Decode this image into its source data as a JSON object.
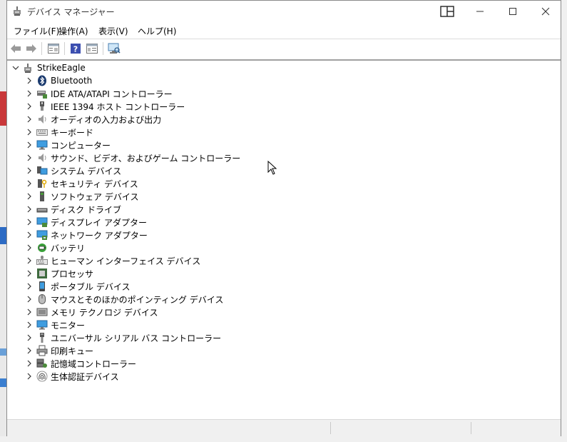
{
  "window": {
    "title": "デバイス マネージャー"
  },
  "menu": [
    "ファイル(F)",
    "操作(A)",
    "表示(V)",
    "ヘルプ(H)"
  ],
  "toolbar": {
    "back_icon": "back-arrow-icon",
    "forward_icon": "forward-arrow-icon",
    "properties_icon": "properties-icon",
    "help_icon": "help-icon",
    "view_icon": "view-icon",
    "scan_icon": "scan-hardware-icon"
  },
  "tree": {
    "root": "StrikeEagle",
    "items": [
      {
        "label": "Bluetooth",
        "icon": "bluetooth-icon"
      },
      {
        "label": "IDE ATA/ATAPI コントローラー",
        "icon": "ide-controller-icon"
      },
      {
        "label": "IEEE 1394 ホスト コントローラー",
        "icon": "ieee1394-icon"
      },
      {
        "label": "オーディオの入力および出力",
        "icon": "speaker-icon"
      },
      {
        "label": "キーボード",
        "icon": "keyboard-icon"
      },
      {
        "label": "コンピューター",
        "icon": "computer-icon"
      },
      {
        "label": "サウンド、ビデオ、およびゲーム コントローラー",
        "icon": "sound-icon"
      },
      {
        "label": "システム デバイス",
        "icon": "system-device-icon"
      },
      {
        "label": "セキュリティ デバイス",
        "icon": "security-device-icon"
      },
      {
        "label": "ソフトウェア デバイス",
        "icon": "software-device-icon"
      },
      {
        "label": "ディスク ドライブ",
        "icon": "disk-drive-icon"
      },
      {
        "label": "ディスプレイ アダプター",
        "icon": "display-adapter-icon"
      },
      {
        "label": "ネットワーク アダプター",
        "icon": "network-adapter-icon"
      },
      {
        "label": "バッテリ",
        "icon": "battery-icon"
      },
      {
        "label": "ヒューマン インターフェイス デバイス",
        "icon": "hid-icon"
      },
      {
        "label": "プロセッサ",
        "icon": "processor-icon"
      },
      {
        "label": "ポータブル デバイス",
        "icon": "portable-device-icon"
      },
      {
        "label": "マウスとそのほかのポインティング デバイス",
        "icon": "mouse-icon"
      },
      {
        "label": "メモリ テクノロジ デバイス",
        "icon": "memory-icon"
      },
      {
        "label": "モニター",
        "icon": "monitor-icon"
      },
      {
        "label": "ユニバーサル シリアル バス コントローラー",
        "icon": "usb-icon"
      },
      {
        "label": "印刷キュー",
        "icon": "printer-icon"
      },
      {
        "label": "記憶域コントローラー",
        "icon": "storage-controller-icon"
      },
      {
        "label": "生体認証デバイス",
        "icon": "fingerprint-icon"
      }
    ]
  },
  "colors": {
    "accent": "#1e7bd3",
    "tree_text": "#000000",
    "statusbar": "#f0f0f0"
  }
}
